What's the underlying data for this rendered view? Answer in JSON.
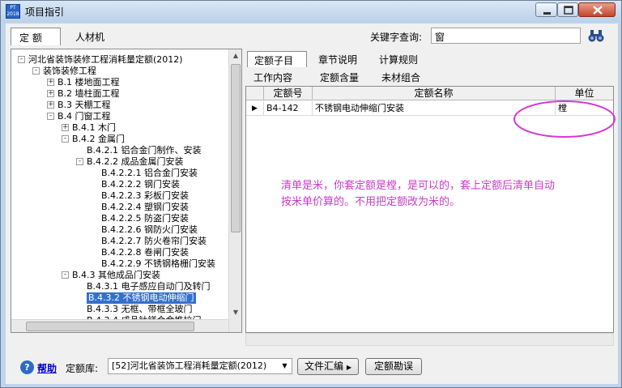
{
  "window": {
    "title": "项目指引",
    "app_icon_text": "PT 2018"
  },
  "top_tabs": [
    {
      "label": "定 额"
    },
    {
      "label": "人材机"
    }
  ],
  "search": {
    "label": "关键字查询:",
    "value": "窗"
  },
  "tree": [
    {
      "label": "河北省装饰装修工程消耗量定额(2012)",
      "exp": "-"
    },
    {
      "label": "装饰装修工程",
      "exp": "-"
    },
    {
      "label": "B.1 楼地面工程",
      "exp": "+"
    },
    {
      "label": "B.2 墙柱面工程",
      "exp": "+"
    },
    {
      "label": "B.3 天棚工程",
      "exp": "+"
    },
    {
      "label": "B.4 门窗工程",
      "exp": "-"
    },
    {
      "label": "B.4.1 木门",
      "exp": "+"
    },
    {
      "label": "B.4.2 金属门",
      "exp": "-"
    },
    {
      "label": "B.4.2.1 铝合金门制作、安装",
      "exp": ""
    },
    {
      "label": "B.4.2.2 成品金属门安装",
      "exp": "-"
    },
    {
      "label": "B.4.2.2.1 铝合金门安装",
      "exp": ""
    },
    {
      "label": "B.4.2.2.2 钢门安装",
      "exp": ""
    },
    {
      "label": "B.4.2.2.3 彩板门安装",
      "exp": ""
    },
    {
      "label": "B.4.2.2.4 塑钢门安装",
      "exp": ""
    },
    {
      "label": "B.4.2.2.5 防盗门安装",
      "exp": ""
    },
    {
      "label": "B.4.2.2.6 钢防火门安装",
      "exp": ""
    },
    {
      "label": "B.4.2.2.7 防火卷帘门安装",
      "exp": ""
    },
    {
      "label": "B.4.2.2.8 卷闸门安装",
      "exp": ""
    },
    {
      "label": "B.4.2.2.9 不锈钢格栅门安装",
      "exp": ""
    },
    {
      "label": "B.4.3 其他成品门安装",
      "exp": "-"
    },
    {
      "label": "B.4.3.1 电子感应自动门及转门",
      "exp": ""
    },
    {
      "label": "B.4.3.2 不锈钢电动伸缩门",
      "exp": "",
      "selected": true
    },
    {
      "label": "B.4.3.3 无框、带框全玻门",
      "exp": ""
    },
    {
      "label": "B.4.3.4 成品钛镁合金推拉门",
      "exp": ""
    },
    {
      "label": "B.4.4 木窗",
      "exp": "+"
    }
  ],
  "tabs_row1": [
    {
      "label": "定额子目"
    },
    {
      "label": "章节说明"
    },
    {
      "label": "计算规则"
    }
  ],
  "tabs_row2": [
    {
      "label": "工作内容"
    },
    {
      "label": "定额含量"
    },
    {
      "label": "未材组合"
    }
  ],
  "grid": {
    "columns": [
      "定额号",
      "定额名称",
      "单位"
    ],
    "rows": [
      {
        "code": "B4-142",
        "name": "不锈钢电动伸缩门安装",
        "unit": "樘"
      }
    ]
  },
  "annotation": {
    "line1": "清单是米，你套定额是樘，是可以的，套上定额后清单自动",
    "line2": "按米单价算的。不用把定额改为米的。",
    "color": "#c93ac9"
  },
  "bottom": {
    "help_label": "帮助",
    "library_label": "定额库:",
    "library_value": "[52]河北省装饰工程消耗量定额(2012)",
    "file_button": "文件汇编",
    "fix_button": "定额勘误"
  }
}
